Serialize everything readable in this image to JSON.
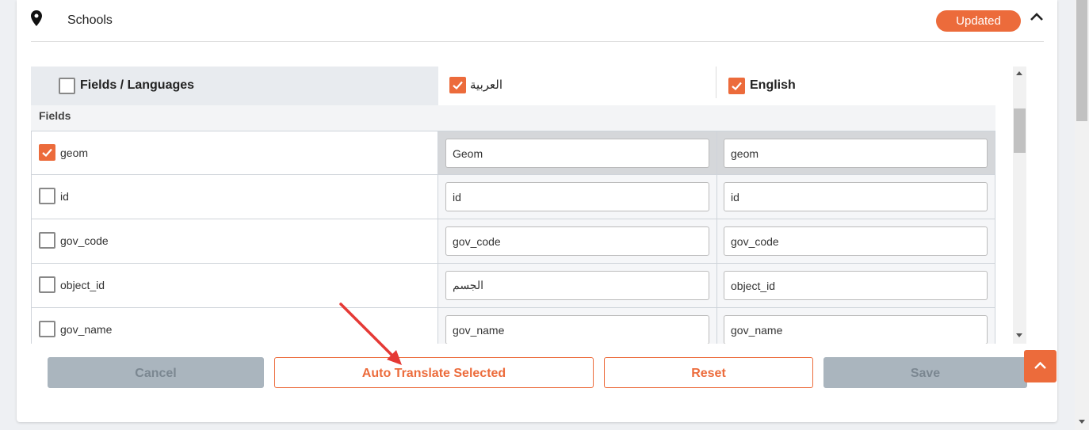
{
  "header": {
    "title": "Schools",
    "badge": "Updated",
    "icons": {
      "location": "map-pin-icon",
      "collapse": "chevron-up-icon"
    }
  },
  "table": {
    "header": {
      "fields_languages": "Fields / Languages",
      "arabic": "العربية",
      "english": "English",
      "arabic_checked": true,
      "english_checked": true
    },
    "section": "Fields",
    "rows": [
      {
        "name": "geom",
        "checked": true,
        "ar": "Geom",
        "en": "geom"
      },
      {
        "name": "id",
        "checked": false,
        "ar": "id",
        "en": "id"
      },
      {
        "name": "gov_code",
        "checked": false,
        "ar": "gov_code",
        "en": "gov_code"
      },
      {
        "name": "object_id",
        "checked": false,
        "ar": "الجسم",
        "en": "object_id"
      },
      {
        "name": "gov_name",
        "checked": false,
        "ar": "gov_name",
        "en": "gov_name"
      }
    ]
  },
  "buttons": {
    "cancel": "Cancel",
    "auto_translate": "Auto Translate Selected",
    "reset": "Reset",
    "save": "Save"
  },
  "colors": {
    "accent": "#ec6b3b",
    "disabled": "#aab5be",
    "annotation_arrow": "#e53935"
  }
}
